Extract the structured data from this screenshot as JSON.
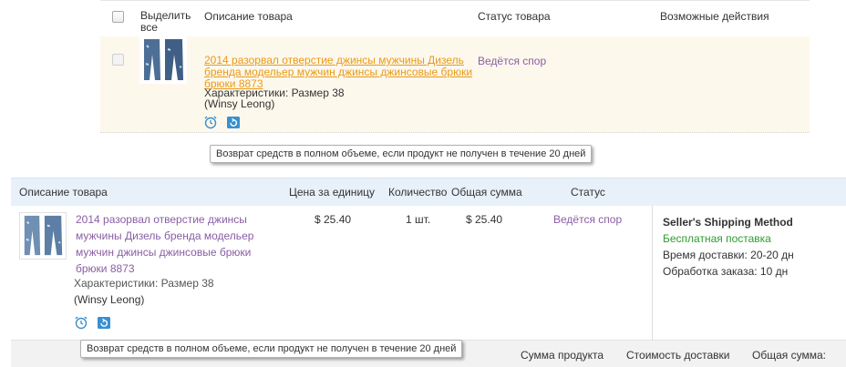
{
  "list": {
    "header": {
      "select_all": "Выделить все",
      "description": "Описание товара",
      "status": "Статус товара",
      "actions": "Возможные действия"
    },
    "item": {
      "title": "2014 разорвал отверстие джинсы мужчины Дизель бренда модельер мужчин джинсы джинсовые брюки брюки 8873",
      "spec": "Характеристики: Размер 38",
      "seller": "(Winsy Leong)",
      "status": "Ведётся спор"
    },
    "tooltip": "Возврат средств в полном объеме, если продукт не получен в течение 20 дней"
  },
  "order": {
    "header": {
      "description": "Описание товара",
      "unit_price": "Цена за единицу",
      "quantity": "Количество",
      "total": "Общая сумма",
      "status": "Статус"
    },
    "item": {
      "title": "2014 разорвал отверстие джинсы мужчины Дизель бренда модельер мужчин джинсы джинсовые брюки брюки 8873",
      "spec": "Характеристики: Размер 38",
      "seller": "(Winsy Leong)",
      "price": "$ 25.40",
      "quantity_num": "1",
      "quantity_unit": "шт.",
      "total": "$ 25.40",
      "status": "Ведётся спор"
    },
    "shipping": {
      "method": "Seller's Shipping Method",
      "free": "Бесплатная поставка",
      "delivery_time": "Время доставки:  20-20 дн",
      "processing_time": "Обработка заказа:  10 дн"
    },
    "tooltip": "Возврат средств в полном объеме, если продукт не получен в течение 20 дней",
    "summary": {
      "product_sum": "Сумма продукта",
      "shipping_cost": "Стоимость доставки",
      "total_sum": "Общая сумма:"
    }
  },
  "icons": {
    "time": "alarm-clock-icon",
    "refund": "refund-icon"
  },
  "colors": {
    "link_orange": "#e99a18",
    "status_purple": "#8a5ea5",
    "free_green": "#2e9d2e",
    "row_highlight": "#fdf8ec",
    "table_header_blue": "#e8f1fa"
  }
}
